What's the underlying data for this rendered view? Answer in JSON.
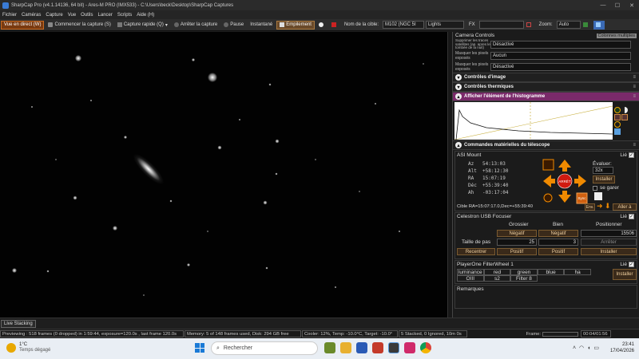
{
  "window": {
    "title": "SharpCap Pro (v4.1.14136, 64 bit) - Ares-M PRO (IMX533) - C:\\Users\\beck\\Desktop\\SharpCap Captures",
    "min": "—",
    "max": "☐",
    "close": "✕"
  },
  "menu": [
    "Fichier",
    "Caméras",
    "Capture",
    "Vue",
    "Outils",
    "Lancer",
    "Scripts",
    "Aide (H)"
  ],
  "toolbar": {
    "live": "Vue en direct (W)",
    "start_capture": "Commencer la capture (S)",
    "quick_capture": "Capture rapide (Q)",
    "stop_capture": "Arrêter la capture",
    "pause": "Pause",
    "snapshot": "Instantané",
    "stack": "Empilement",
    "target_label": "Nom de la cible:",
    "target_value": "M102 (NGC 5I",
    "frame_type": "Lights",
    "fx_label": "FX",
    "zoom_label": "Zoom:",
    "zoom_value": "Auto"
  },
  "panel": {
    "camera_controls": "Camera Controls",
    "multi_columns": "Colonnes multiples",
    "rows": [
      {
        "label": "Supprimer les traces satellites (ap. apres le tombée de la nuit)",
        "value": "Désactivé"
      },
      {
        "label": "Masquer les pixels exposés",
        "value": "Aucun"
      },
      {
        "label": "Masquer les pixels exposés",
        "value": "Désactivé"
      }
    ],
    "image_controls": "Contrôles d'image",
    "thermal_controls": "Contrôles thermiques",
    "histogram": "Afficher l'élément de l'histogramme",
    "telescope": "Commandes matérielles du télescope",
    "mount": {
      "name": "ASI Mount",
      "az_label": "Az",
      "az": "54:13:03",
      "alt_label": "Alt",
      "alt": "+58:12:30",
      "ra_label": "RA",
      "ra": "15:07:19",
      "dec_label": "Déc",
      "dec": "+55:39:40",
      "ah_label": "Ah",
      "ah": "-03:17:04",
      "evaluate_label": "Évaluer:",
      "rate": "32x",
      "install": "Installer",
      "park": "se garer",
      "stop": "ARRÊT",
      "sync": "Sync",
      "target": "Cible   RA=15:07:17.0,Dec=+55:39:40",
      "env": "Env.",
      "goto": "Aller à",
      "lie": "Lié"
    },
    "focuser": {
      "name": "Celestron USB Focuser",
      "lie": "Lié",
      "coarse": "Grossier",
      "fine": "Bien",
      "position": "Positionner",
      "neg1": "Négatif",
      "neg2": "Négatif",
      "position_value": "15506",
      "step_label": "Taille de pas",
      "step1": "25",
      "step2": "3",
      "stop": "Arrêter",
      "recenter": "Recentrer",
      "pos1": "Positif",
      "pos2": "Positif",
      "install": "Installer"
    },
    "filterwheel": {
      "name": "PlayerOne FilterWheel 1",
      "lie": "Lié",
      "filters": [
        "luminance",
        "red",
        "green",
        "blue",
        "ha",
        "OIII",
        "s2",
        "Filter 8"
      ],
      "install": "Installer"
    },
    "notes": "Remarques"
  },
  "statusbar": {
    "tab": "Live Stacking",
    "preview": "Previewing : 518 frames (0 dropped) in 1:59:44, exposure=120.0s , last frame 120.0s",
    "memory": "Memory: 5 of 148 frames used, Disk: 294 GB free",
    "cooler": "Cooler: 12%, Temp: -10.0°C, Target: -10.0°",
    "stacked": "5 Stacked, 0 Ignored, 10m 0s",
    "frame_label": "Frame",
    "timer": "00:04/01:56"
  },
  "taskbar": {
    "weather_temp": "1°C",
    "weather_desc": "Temps dégagé",
    "search": "Rechercher",
    "time": "23:41",
    "date": "17/04/2026"
  },
  "colors": {
    "accent": "#c86a20",
    "hist_header": "#7a2a6a",
    "arrow": "#f08a00"
  }
}
